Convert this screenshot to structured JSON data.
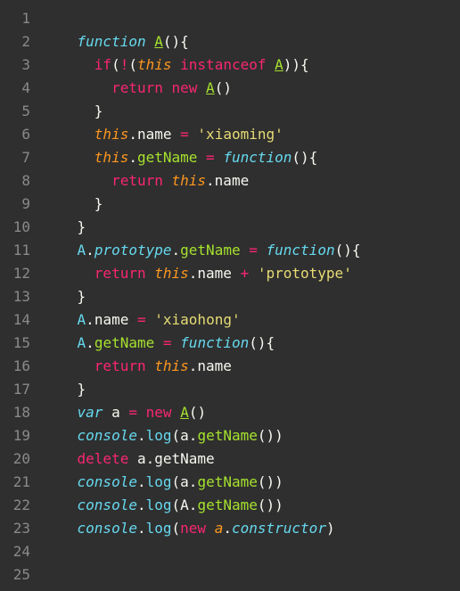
{
  "editor": {
    "line_numbers": [
      "1",
      "2",
      "3",
      "4",
      "5",
      "6",
      "7",
      "8",
      "9",
      "10",
      "11",
      "12",
      "13",
      "14",
      "15",
      "16",
      "17",
      "18",
      "19",
      "20",
      "21",
      "22",
      "23",
      "24",
      "25"
    ],
    "lines": [
      [],
      [
        {
          "c": "kw-storage",
          "t": "function"
        },
        {
          "c": "punct",
          "t": " "
        },
        {
          "c": "fn-name",
          "t": "A"
        },
        {
          "c": "punct",
          "t": "(){"
        }
      ],
      [
        {
          "c": "punct",
          "t": "  "
        },
        {
          "c": "kw-op",
          "t": "if"
        },
        {
          "c": "punct",
          "t": "("
        },
        {
          "c": "kw-op",
          "t": "!"
        },
        {
          "c": "punct",
          "t": "("
        },
        {
          "c": "obj",
          "t": "this"
        },
        {
          "c": "punct",
          "t": " "
        },
        {
          "c": "kw-op",
          "t": "instanceof"
        },
        {
          "c": "punct",
          "t": " "
        },
        {
          "c": "fn-name",
          "t": "A"
        },
        {
          "c": "punct",
          "t": ")){"
        }
      ],
      [
        {
          "c": "punct",
          "t": "    "
        },
        {
          "c": "kw-op",
          "t": "return"
        },
        {
          "c": "punct",
          "t": " "
        },
        {
          "c": "kw-op",
          "t": "new"
        },
        {
          "c": "punct",
          "t": " "
        },
        {
          "c": "fn-name",
          "t": "A"
        },
        {
          "c": "punct",
          "t": "()"
        }
      ],
      [
        {
          "c": "punct",
          "t": "  }"
        }
      ],
      [
        {
          "c": "punct",
          "t": "  "
        },
        {
          "c": "obj",
          "t": "this"
        },
        {
          "c": "punct",
          "t": "."
        },
        {
          "c": "ident",
          "t": "name"
        },
        {
          "c": "punct",
          "t": " "
        },
        {
          "c": "kw-op",
          "t": "="
        },
        {
          "c": "punct",
          "t": " "
        },
        {
          "c": "str",
          "t": "'xiaoming'"
        }
      ],
      [
        {
          "c": "punct",
          "t": "  "
        },
        {
          "c": "obj",
          "t": "this"
        },
        {
          "c": "punct",
          "t": "."
        },
        {
          "c": "fn-call",
          "t": "getName"
        },
        {
          "c": "punct",
          "t": " "
        },
        {
          "c": "kw-op",
          "t": "="
        },
        {
          "c": "punct",
          "t": " "
        },
        {
          "c": "kw-storage",
          "t": "function"
        },
        {
          "c": "punct",
          "t": "(){"
        }
      ],
      [
        {
          "c": "punct",
          "t": "    "
        },
        {
          "c": "kw-op",
          "t": "return"
        },
        {
          "c": "punct",
          "t": " "
        },
        {
          "c": "obj",
          "t": "this"
        },
        {
          "c": "punct",
          "t": "."
        },
        {
          "c": "ident",
          "t": "name"
        }
      ],
      [
        {
          "c": "punct",
          "t": "  }"
        }
      ],
      [
        {
          "c": "punct",
          "t": "}"
        }
      ],
      [
        {
          "c": "prop",
          "t": "A"
        },
        {
          "c": "punct",
          "t": "."
        },
        {
          "c": "builtin",
          "t": "prototype"
        },
        {
          "c": "punct",
          "t": "."
        },
        {
          "c": "fn-call",
          "t": "getName"
        },
        {
          "c": "punct",
          "t": " "
        },
        {
          "c": "kw-op",
          "t": "="
        },
        {
          "c": "punct",
          "t": " "
        },
        {
          "c": "kw-storage",
          "t": "function"
        },
        {
          "c": "punct",
          "t": "(){"
        }
      ],
      [
        {
          "c": "punct",
          "t": "  "
        },
        {
          "c": "kw-op",
          "t": "return"
        },
        {
          "c": "punct",
          "t": " "
        },
        {
          "c": "obj",
          "t": "this"
        },
        {
          "c": "punct",
          "t": "."
        },
        {
          "c": "ident",
          "t": "name"
        },
        {
          "c": "punct",
          "t": " "
        },
        {
          "c": "kw-op",
          "t": "+"
        },
        {
          "c": "punct",
          "t": " "
        },
        {
          "c": "str",
          "t": "'prototype'"
        }
      ],
      [
        {
          "c": "punct",
          "t": "}"
        }
      ],
      [
        {
          "c": "prop",
          "t": "A"
        },
        {
          "c": "punct",
          "t": "."
        },
        {
          "c": "ident",
          "t": "name"
        },
        {
          "c": "punct",
          "t": " "
        },
        {
          "c": "kw-op",
          "t": "="
        },
        {
          "c": "punct",
          "t": " "
        },
        {
          "c": "str",
          "t": "'xiaohong'"
        }
      ],
      [
        {
          "c": "prop",
          "t": "A"
        },
        {
          "c": "punct",
          "t": "."
        },
        {
          "c": "fn-call",
          "t": "getName"
        },
        {
          "c": "punct",
          "t": " "
        },
        {
          "c": "kw-op",
          "t": "="
        },
        {
          "c": "punct",
          "t": " "
        },
        {
          "c": "kw-storage",
          "t": "function"
        },
        {
          "c": "punct",
          "t": "(){"
        }
      ],
      [
        {
          "c": "punct",
          "t": "  "
        },
        {
          "c": "kw-op",
          "t": "return"
        },
        {
          "c": "punct",
          "t": " "
        },
        {
          "c": "obj",
          "t": "this"
        },
        {
          "c": "punct",
          "t": "."
        },
        {
          "c": "ident",
          "t": "name"
        }
      ],
      [
        {
          "c": "punct",
          "t": "}"
        }
      ],
      [
        {
          "c": "kw-storage",
          "t": "var"
        },
        {
          "c": "punct",
          "t": " "
        },
        {
          "c": "ident",
          "t": "a"
        },
        {
          "c": "punct",
          "t": " "
        },
        {
          "c": "kw-op",
          "t": "="
        },
        {
          "c": "punct",
          "t": " "
        },
        {
          "c": "kw-op",
          "t": "new"
        },
        {
          "c": "punct",
          "t": " "
        },
        {
          "c": "fn-name",
          "t": "A"
        },
        {
          "c": "punct",
          "t": "()"
        }
      ],
      [
        {
          "c": "console",
          "t": "console"
        },
        {
          "c": "punct",
          "t": "."
        },
        {
          "c": "log",
          "t": "log"
        },
        {
          "c": "punct",
          "t": "("
        },
        {
          "c": "ident",
          "t": "a"
        },
        {
          "c": "punct",
          "t": "."
        },
        {
          "c": "fn-call",
          "t": "getName"
        },
        {
          "c": "punct",
          "t": "())"
        }
      ],
      [
        {
          "c": "kw-op",
          "t": "delete"
        },
        {
          "c": "punct",
          "t": " "
        },
        {
          "c": "ident",
          "t": "a"
        },
        {
          "c": "punct",
          "t": "."
        },
        {
          "c": "ident",
          "t": "getName"
        }
      ],
      [
        {
          "c": "console",
          "t": "console"
        },
        {
          "c": "punct",
          "t": "."
        },
        {
          "c": "log",
          "t": "log"
        },
        {
          "c": "punct",
          "t": "("
        },
        {
          "c": "ident",
          "t": "a"
        },
        {
          "c": "punct",
          "t": "."
        },
        {
          "c": "fn-call",
          "t": "getName"
        },
        {
          "c": "punct",
          "t": "())"
        }
      ],
      [
        {
          "c": "console",
          "t": "console"
        },
        {
          "c": "punct",
          "t": "."
        },
        {
          "c": "log",
          "t": "log"
        },
        {
          "c": "punct",
          "t": "("
        },
        {
          "c": "ident",
          "t": "A"
        },
        {
          "c": "punct",
          "t": "."
        },
        {
          "c": "fn-call",
          "t": "getName"
        },
        {
          "c": "punct",
          "t": "())"
        }
      ],
      [
        {
          "c": "console",
          "t": "console"
        },
        {
          "c": "punct",
          "t": "."
        },
        {
          "c": "log",
          "t": "log"
        },
        {
          "c": "punct",
          "t": "("
        },
        {
          "c": "kw-op",
          "t": "new"
        },
        {
          "c": "punct",
          "t": " "
        },
        {
          "c": "obj",
          "t": "a"
        },
        {
          "c": "punct",
          "t": "."
        },
        {
          "c": "builtin",
          "t": "constructor"
        },
        {
          "c": "punct",
          "t": ")"
        }
      ],
      [],
      []
    ],
    "indent_prefix": "    "
  }
}
